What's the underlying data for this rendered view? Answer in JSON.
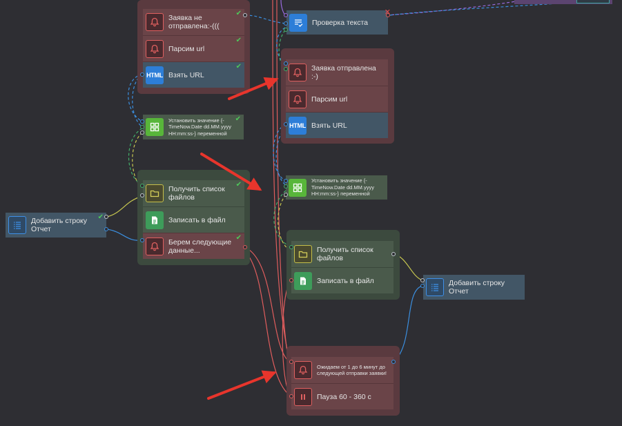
{
  "nodes": {
    "left_not_sent": "Заявка не отправлена:-(((",
    "left_parse_url": "Парсим url",
    "left_take_url": "Взять URL",
    "left_set_value": "Установить значение {-TimeNow.Date dd.MM.yyyy HH:mm:ss-} переменной",
    "left_get_files": "Получить список файлов",
    "left_write_file": "Записать в файл",
    "left_next_data": "Берем следующие данные...",
    "left_add_row": "Добавить строку Отчет",
    "check_text": "Проверка текста",
    "right_sent": "Заявка отправлена :-)",
    "right_parse_url": "Парсим url",
    "right_take_url": "Взять URL",
    "right_set_value": "Установить значение {-TimeNow.Date dd.MM.yyyy HH:mm:ss-} переменной",
    "right_get_files": "Получить список файлов",
    "right_write_file": "Записать в файл",
    "right_add_row": "Добавить строку Отчет",
    "wait": "Ожидаем от 1 до 6 минут до следующей отправки заявки!",
    "pause": "Пауза 60 - 360 с"
  },
  "icon_labels": {
    "html": "HTML"
  },
  "icons": {
    "bell": "bell-icon",
    "html": "html-icon",
    "grid": "grid-icon",
    "folder": "folder-icon",
    "file": "file-icon",
    "list": "list-icon",
    "text_check": "text-check-icon",
    "pause": "pause-icon"
  },
  "colors": {
    "background": "#2e2e33",
    "group_red": "#5a3a3f",
    "group_green": "#3c4a3e",
    "node_blue": "#425666",
    "wire_blue": "#3b8fe0",
    "wire_green": "#43b06a",
    "wire_yellow": "#c8c850",
    "wire_red": "#e05d5d",
    "wire_purple": "#9a6be0",
    "arrow_red": "#e8352c",
    "tick_green": "#4ec95a"
  }
}
